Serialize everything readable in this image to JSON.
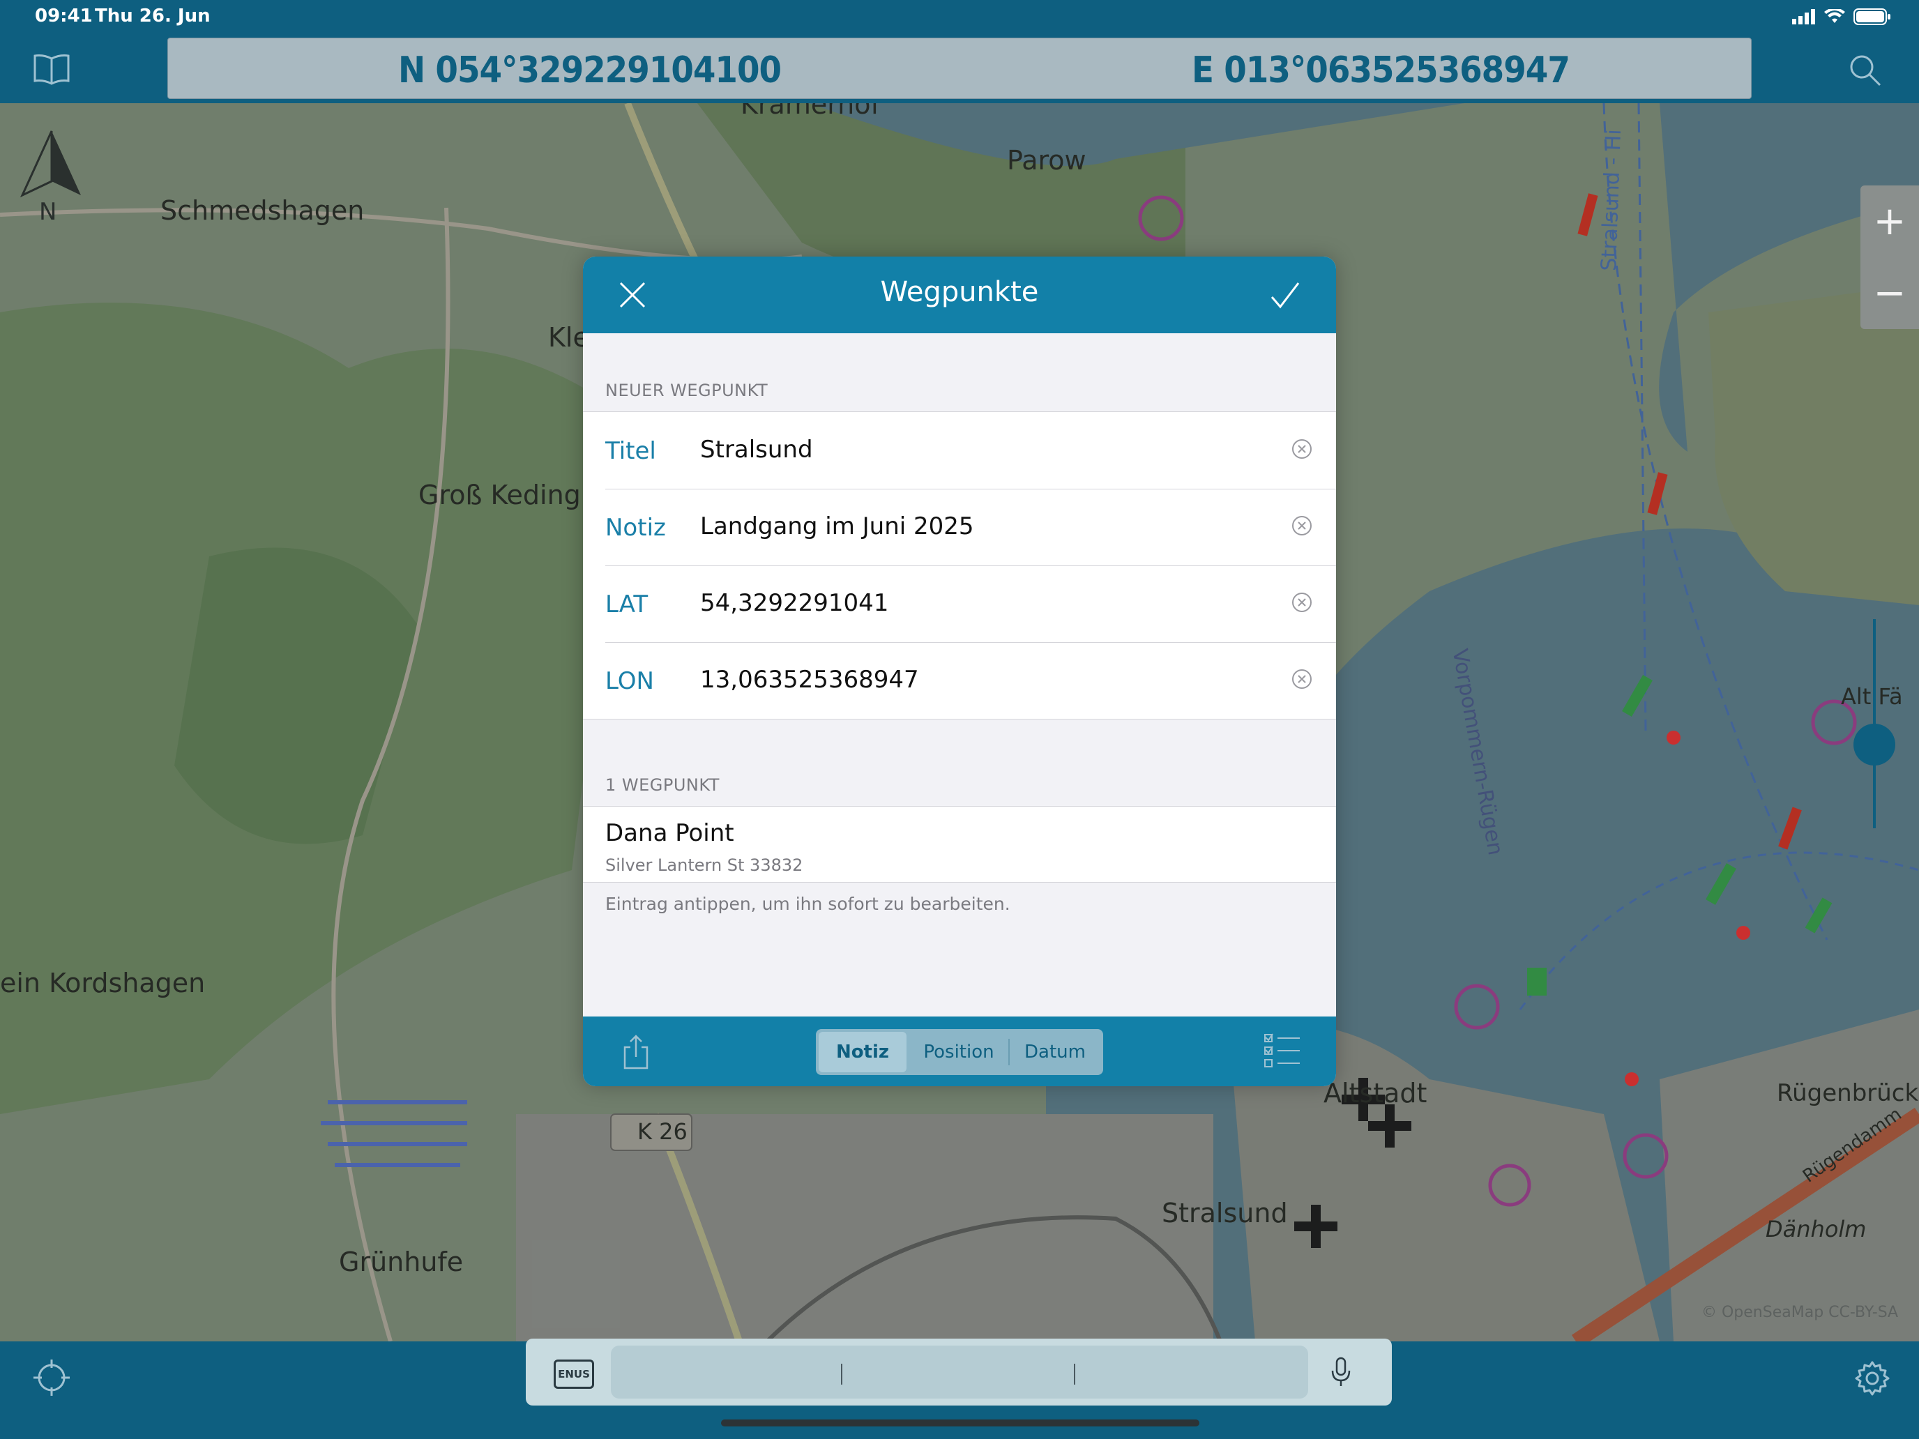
{
  "status_bar": {
    "time": "09:41",
    "date": "Thu 26. Jun"
  },
  "position_bar": {
    "lat": "N 054°329229104100",
    "lon": "E 013°063525368947"
  },
  "map": {
    "compass_label": "N",
    "zoom_in": "+",
    "zoom_out": "−",
    "places": [
      "Kramerhof",
      "Parow",
      "Schmedshagen",
      "Kle",
      "Groß Keding",
      "ein Kordshagen",
      "Grünhufe",
      "Stralsund",
      "Altstadt",
      "Rügenbrück",
      "Dänholm",
      "Vorpommern-Rügen",
      "Stralsund - Hi",
      "K 26",
      "Rügendamm",
      "Alt Fä"
    ],
    "attribution": "© OpenSeaMap CC-BY-SA"
  },
  "dialog": {
    "title": "Wegpunkte",
    "section_new": "NEUER WEGPUNKT",
    "fields": [
      {
        "label": "Titel",
        "value": "Stralsund"
      },
      {
        "label": "Notiz",
        "value": "Landgang im Juni 2025"
      },
      {
        "label": "LAT",
        "value": "54,3292291041"
      },
      {
        "label": "LON",
        "value": "13,063525368947"
      }
    ],
    "section_list": "1 WEGPUNKT",
    "waypoint": {
      "title": "Dana Point",
      "subtitle": "Silver Lantern St 33832"
    },
    "hint": "Eintrag antippen, um ihn sofort zu bearbeiten.",
    "tabs": [
      "Notiz",
      "Position",
      "Datum"
    ],
    "selected_tab": "Notiz"
  },
  "fab_label": "+",
  "search": {
    "keyboard_label": "ENUS"
  },
  "colors": {
    "primary": "#0e5f80",
    "dialog_header": "#1280a8",
    "label_blue": "#1a7fa8"
  }
}
